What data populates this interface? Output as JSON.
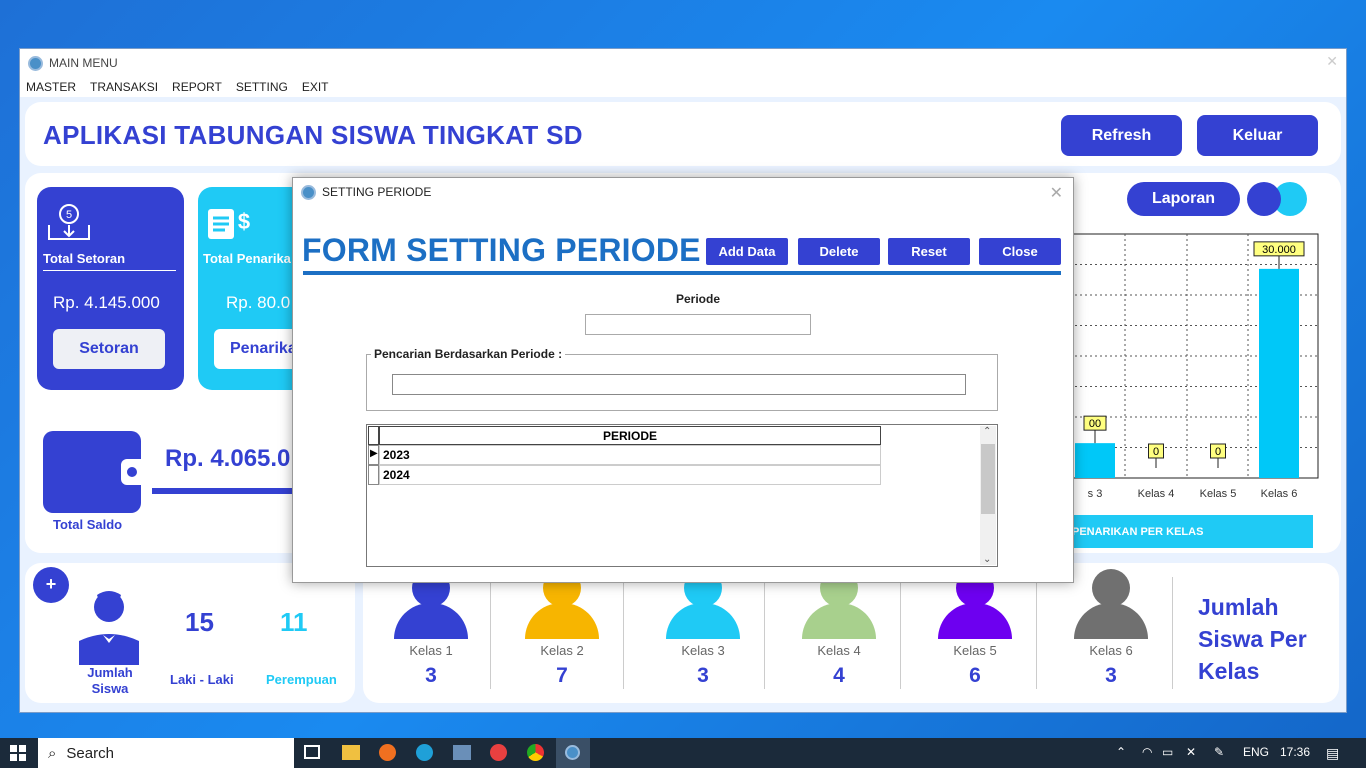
{
  "main_window": {
    "title": "MAIN MENU",
    "menu": [
      "MASTER",
      "TRANSAKSI",
      "REPORT",
      "SETTING",
      "EXIT"
    ],
    "app_title": "APLIKASI TABUNGAN SISWA TINGKAT SD",
    "refresh_label": "Refresh",
    "keluar_label": "Keluar",
    "setoran": {
      "label": "Total Setoran",
      "value": "Rp. 4.145.000",
      "button": "Setoran"
    },
    "penarikan": {
      "label": "Total Penarika",
      "value": "Rp. 80.0",
      "button": "Penarika"
    },
    "saldo": {
      "value": "Rp. 4.065.0",
      "label": "Total Saldo"
    },
    "jumlah_siswa": {
      "label_line1": "Jumlah",
      "label_line2": "Siswa",
      "laki_count": "15",
      "laki_label": "Laki - Laki",
      "perempuan_count": "11",
      "perempuan_label": "Perempuan",
      "add_label": "+"
    },
    "laporan_label": "Laporan",
    "chart_banner": "PENARIKAN PER KELAS",
    "kelas": [
      {
        "name": "Kelas 1",
        "count": "3",
        "color": "#3441d2"
      },
      {
        "name": "Kelas 2",
        "count": "7",
        "color": "#f7b500"
      },
      {
        "name": "Kelas 3",
        "count": "3",
        "color": "#1fcaf5"
      },
      {
        "name": "Kelas 4",
        "count": "4",
        "color": "#a8d08d"
      },
      {
        "name": "Kelas 5",
        "count": "6",
        "color": "#6d00f0"
      },
      {
        "name": "Kelas 6",
        "count": "3",
        "color": "#707070"
      }
    ],
    "jumlah_per_kelas_l1": "Jumlah",
    "jumlah_per_kelas_l2": "Siswa Per",
    "jumlah_per_kelas_l3": "Kelas"
  },
  "chart_data": {
    "type": "bar",
    "categories": [
      "Kelas 3",
      "Kelas 4",
      "Kelas 5",
      "Kelas 6"
    ],
    "visible_tick_labels": [
      "s 3",
      "Kelas 4",
      "Kelas 5",
      "Kelas 6"
    ],
    "values": [
      5000,
      0,
      0,
      30000
    ],
    "data_labels": [
      "00",
      "0",
      "0",
      "30.000"
    ],
    "grid": true,
    "bar_color": "#00c8f8"
  },
  "dialog": {
    "title": "SETTING PERIODE",
    "form_title": "FORM SETTING PERIODE",
    "buttons": [
      "Add Data",
      "Delete",
      "Reset",
      "Close"
    ],
    "periode_label": "Periode",
    "periode_value": "",
    "search_group_label": "Pencarian Berdasarkan Periode :",
    "search_value": "",
    "grid_header": "PERIODE",
    "rows": [
      "2023",
      "2024"
    ]
  },
  "taskbar": {
    "search_label": "Search",
    "lang": "ENG",
    "time": "17:36"
  }
}
